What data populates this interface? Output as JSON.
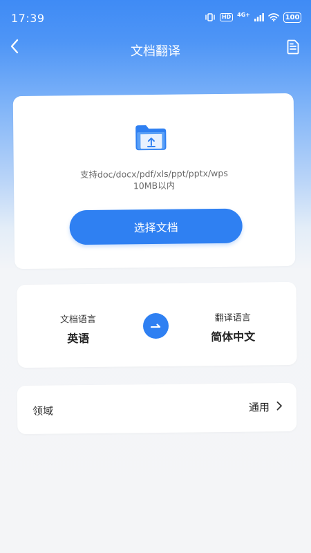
{
  "status_bar": {
    "time": "17:39",
    "hd_label": "HD",
    "signal_label": "4G+",
    "battery": "100"
  },
  "nav": {
    "title": "文档翻译",
    "back_icon": "chevron-left-icon",
    "history_icon": "document-icon"
  },
  "upload": {
    "icon": "folder-upload-icon",
    "support_line1": "支持doc/docx/pdf/xls/ppt/pptx/wps",
    "support_line2": "10MB以内",
    "button_label": "选择文档"
  },
  "languages": {
    "source_caption": "文档语言",
    "source_value": "英语",
    "target_caption": "翻译语言",
    "target_value": "简体中文",
    "swap_icon": "arrow-right-icon"
  },
  "domain": {
    "label": "领域",
    "value": "通用",
    "chevron_icon": "chevron-right-icon"
  },
  "colors": {
    "accent": "#2f80f2",
    "header_blue": "#3f8bf5",
    "background": "#f4f5f7"
  }
}
